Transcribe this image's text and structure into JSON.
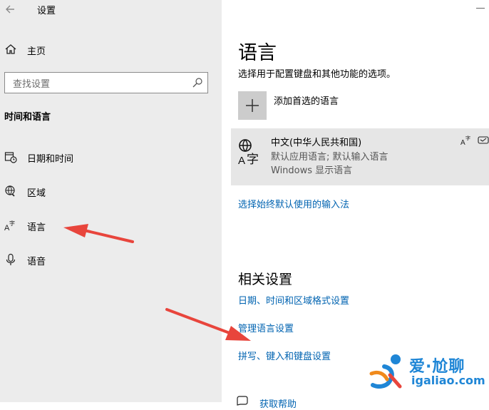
{
  "window": {
    "title": "设置"
  },
  "sidebar": {
    "home_label": "主页",
    "search_placeholder": "查找设置",
    "section_title": "时间和语言",
    "items": [
      {
        "label": "日期和时间",
        "icon": "calendar-clock-icon"
      },
      {
        "label": "区域",
        "icon": "globe-icon"
      },
      {
        "label": "语言",
        "icon": "language-icon"
      },
      {
        "label": "语音",
        "icon": "microphone-icon"
      }
    ]
  },
  "main": {
    "title": "语言",
    "subtitle": "选择用于配置键盘和其他功能的选项。",
    "add_language_label": "添加首选的语言",
    "language": {
      "name": "中文(中华人民共和国)",
      "detail1": "默认应用语言; 默认输入语言",
      "detail2": "Windows 显示语言"
    },
    "input_method_link": "选择始终默认使用的输入法",
    "related": {
      "heading": "相关设置",
      "links": [
        "日期、时间和区域格式设置",
        "管理语言设置",
        "拼写、键入和键盘设置"
      ]
    },
    "help_label": "获取帮助"
  },
  "watermark": {
    "name": "爱·尬聊",
    "url": "igaliao.com"
  },
  "colors": {
    "accent": "#0063b1",
    "arrow": "#e8453c",
    "watermark": "#1f86d6"
  }
}
